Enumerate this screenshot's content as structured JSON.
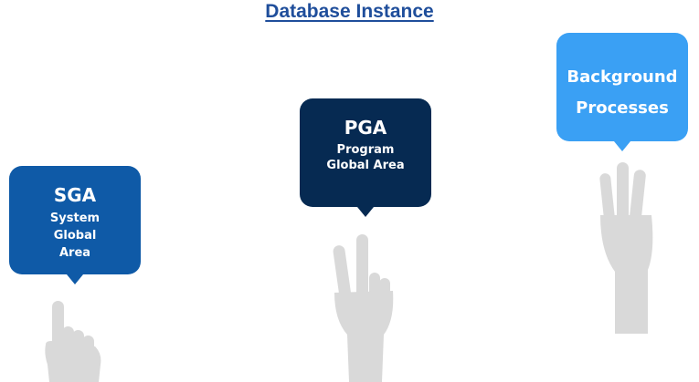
{
  "title": "Database Instance",
  "bubbles": {
    "sga": {
      "heading": "SGA",
      "subtitle": "System Global Area",
      "color": "#0f5aa7"
    },
    "pga": {
      "heading": "PGA",
      "subtitle": "Program Global Area",
      "color": "#062a52"
    },
    "background": {
      "heading": "Background Processes",
      "color": "#3aa0f4"
    }
  },
  "hands": {
    "color": "#d9d9d9",
    "sga_fingers_raised": 1,
    "pga_fingers_raised": 2,
    "background_fingers_raised": 3
  }
}
